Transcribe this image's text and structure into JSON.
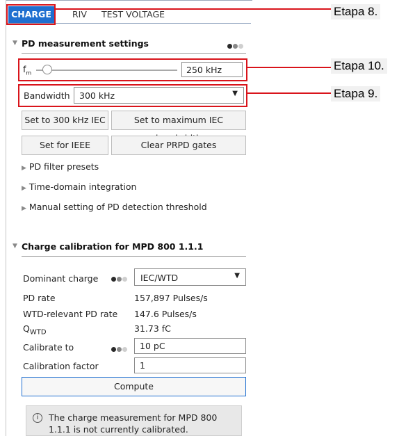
{
  "tabs": [
    {
      "label": "CHARGE",
      "active": true
    },
    {
      "label": "RIV",
      "active": false
    },
    {
      "label": "TEST VOLTAGE",
      "active": false
    }
  ],
  "pd_settings": {
    "title": "PD measurement settings",
    "fm_label": "f",
    "fm_sub": "m",
    "fm_value": "250 kHz",
    "bandwidth_label": "Bandwidth",
    "bandwidth_value": "300 kHz",
    "buttons": {
      "set_300": "Set to 300 kHz IEC",
      "set_max": "Set to maximum IEC bandwidth",
      "set_ieee": "Set for IEEE",
      "clear_prpd": "Clear PRPD gates"
    },
    "collapsed": [
      "PD filter presets",
      "Time-domain integration",
      "Manual setting of PD detection threshold"
    ]
  },
  "calibration": {
    "title": "Charge calibration for MPD 800 1.1.1",
    "dominant_charge_label": "Dominant charge",
    "dominant_charge_value": "IEC/WTD",
    "pd_rate_label": "PD rate",
    "pd_rate_value": "157,897 Pulses/s",
    "wtd_rate_label": "WTD-relevant PD rate",
    "wtd_rate_value": "147.6 Pulses/s",
    "qwtd_label": "Q",
    "qwtd_sub": "WTD",
    "qwtd_value": "31.73 fC",
    "calibrate_to_label": "Calibrate to",
    "calibrate_to_value": "10 pC",
    "cal_factor_label": "Calibration factor",
    "cal_factor_value": "1",
    "compute_label": "Compute",
    "info_line1": "The charge measurement for MPD 800",
    "info_line2": "1.1.1 is not currently calibrated."
  },
  "callouts": {
    "etapa8": "Etapa 8.",
    "etapa10": "Etapa 10.",
    "etapa9": "Etapa 9."
  },
  "fm_slider_position": 0.08,
  "colors": {
    "accent": "#1f6fd0",
    "highlight": "#d9141b"
  }
}
